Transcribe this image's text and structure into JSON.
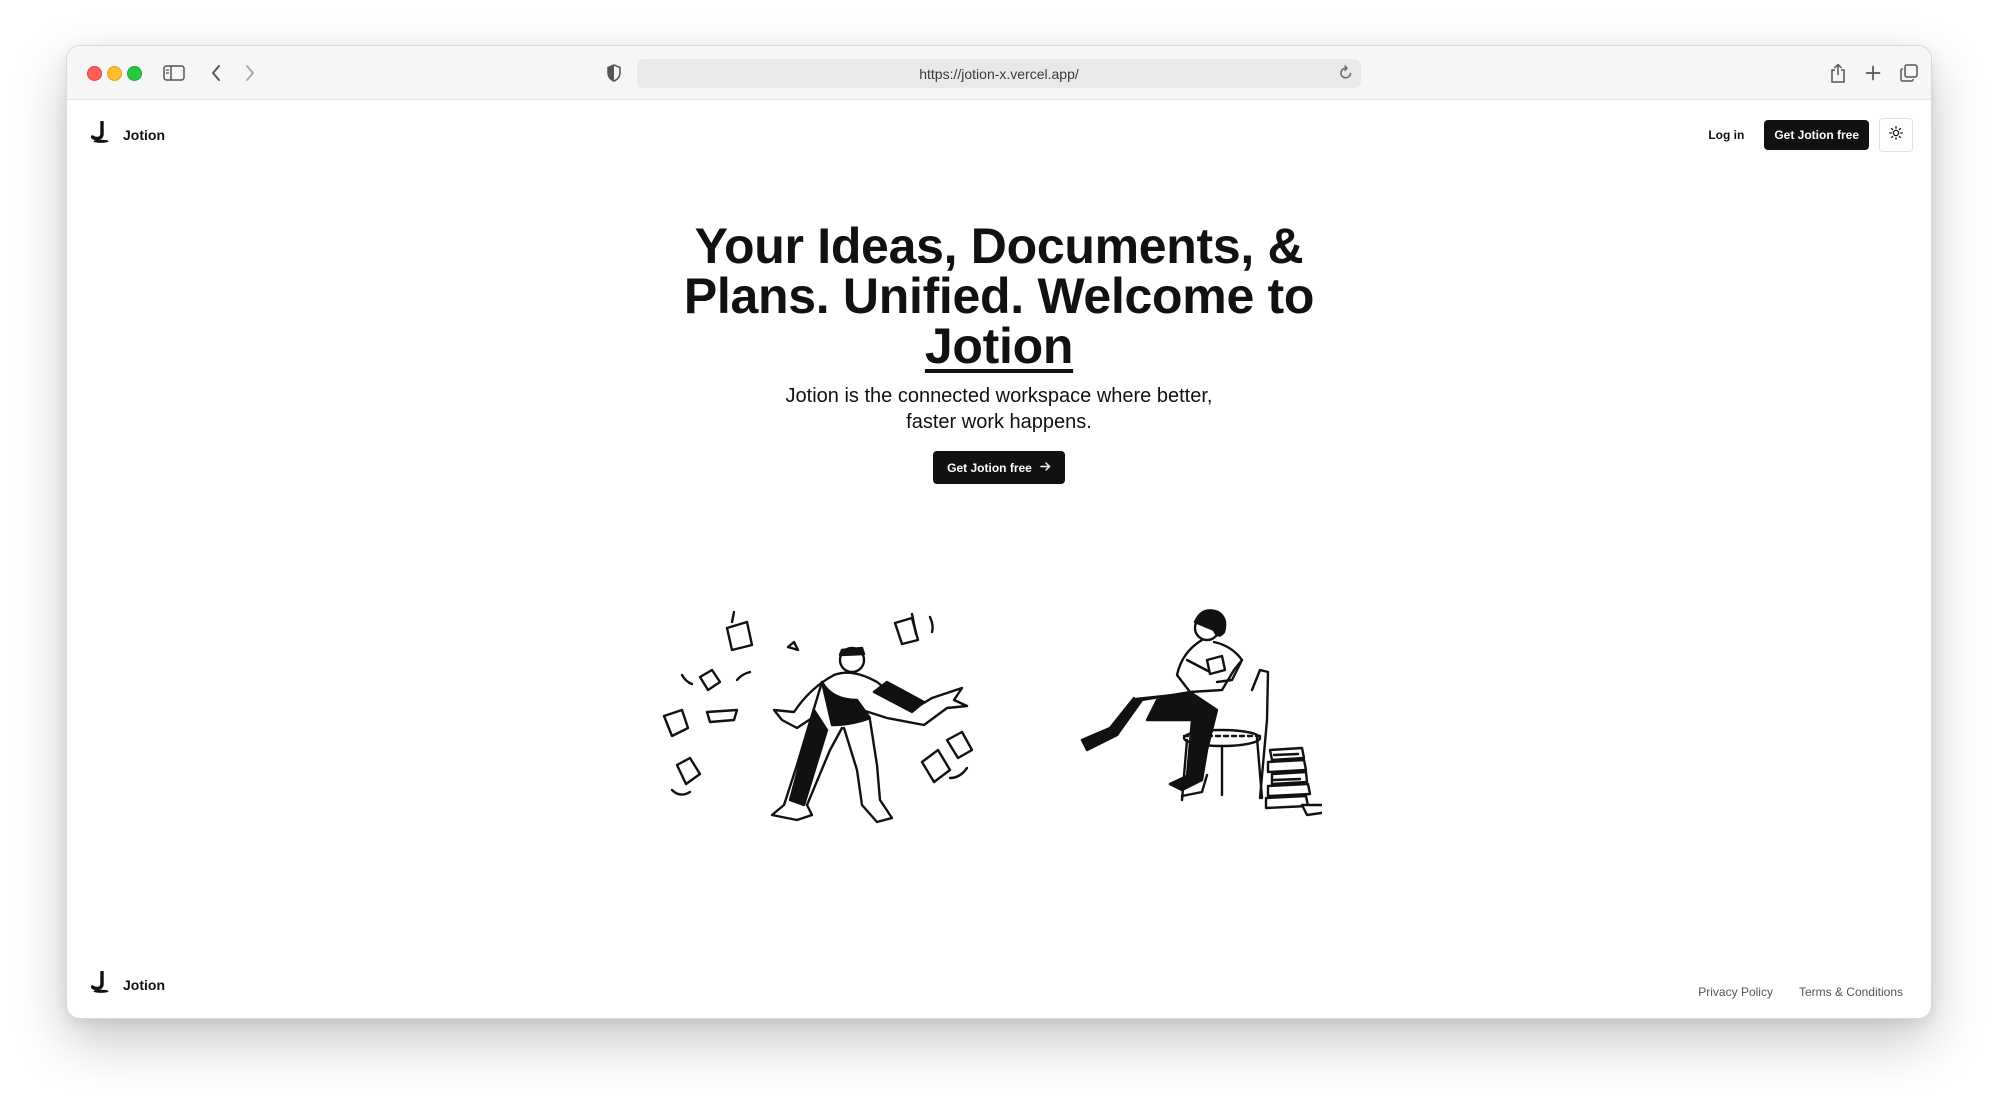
{
  "browser": {
    "url": "https://jotion-x.vercel.app/"
  },
  "nav": {
    "brand": "Jotion",
    "login": "Log in",
    "cta": "Get Jotion free"
  },
  "hero": {
    "title_part1": "Your Ideas, Documents, & Plans. Unified. Welcome to ",
    "title_brand": "Jotion",
    "subtitle": "Jotion is the connected workspace where better, faster work happens.",
    "cta": "Get Jotion free"
  },
  "footer": {
    "brand": "Jotion",
    "links": [
      "Privacy Policy",
      "Terms & Conditions"
    ]
  },
  "colors": {
    "primary": "#111111",
    "background": "#ffffff",
    "muted_text": "#555555"
  },
  "icons": [
    "sidebar-icon",
    "back-icon",
    "forward-icon",
    "shield-icon",
    "reload-icon",
    "share-icon",
    "new-tab-icon",
    "tabs-icon",
    "jotion-logo",
    "sun-icon",
    "arrow-right-icon"
  ]
}
